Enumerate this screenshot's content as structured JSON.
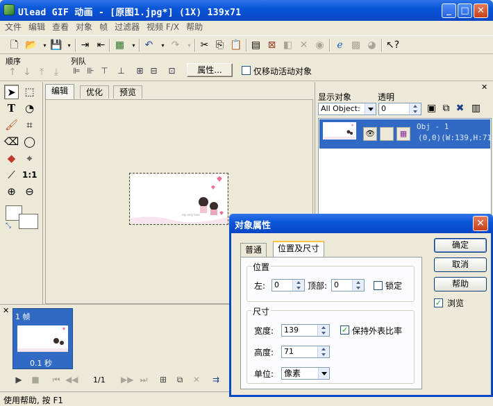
{
  "window": {
    "title": "Ulead GIF 动画 - [原图1.jpg*] (1X) 139x71"
  },
  "menu": [
    "文件",
    "编辑",
    "查看",
    "对象",
    "帧",
    "过滤器",
    "视频 F/X",
    "帮助"
  ],
  "object_bar": {
    "order_label": "顺序",
    "queue_label": "列队",
    "properties_button": "属性...",
    "move_active_only_label": "仅移动活动对象",
    "move_active_only_checked": false
  },
  "edit_tabs": [
    "编辑",
    "优化",
    "预览"
  ],
  "object_manager": {
    "show_objects_label": "显示对象",
    "show_objects_value": "All Object:",
    "opacity_label": "透明",
    "opacity_value": "0",
    "object_name": "Obj - 1",
    "object_info": "(0,0)(W:139,H:71)"
  },
  "frame_panel": {
    "frame_label": "1 帧",
    "frame_delay": "0.1 秒",
    "frame_counter": "1/1"
  },
  "status": {
    "text": "使用帮助, 按 F1"
  },
  "dialog": {
    "title": "对象属性",
    "tabs": [
      "普通",
      "位置及尺寸"
    ],
    "active_tab": "位置及尺寸",
    "position_group": "位置",
    "left_label": "左:",
    "left_value": "0",
    "top_label": "顶部:",
    "top_value": "0",
    "lock_label": "锁定",
    "lock_checked": false,
    "size_group": "尺寸",
    "width_label": "宽度:",
    "width_value": "139",
    "keep_ratio_label": "保持外表比率",
    "keep_ratio_checked": true,
    "height_label": "高度:",
    "height_value": "71",
    "unit_label": "单位:",
    "unit_value": "像素",
    "ok_button": "确定",
    "cancel_button": "取消",
    "help_button": "帮助",
    "preview_label": "浏览",
    "preview_checked": true
  },
  "colors": {
    "titlebar": "#0a55d9",
    "selection": "#316ac5",
    "face": "#ece9d8",
    "close_button": "#c7401b"
  }
}
